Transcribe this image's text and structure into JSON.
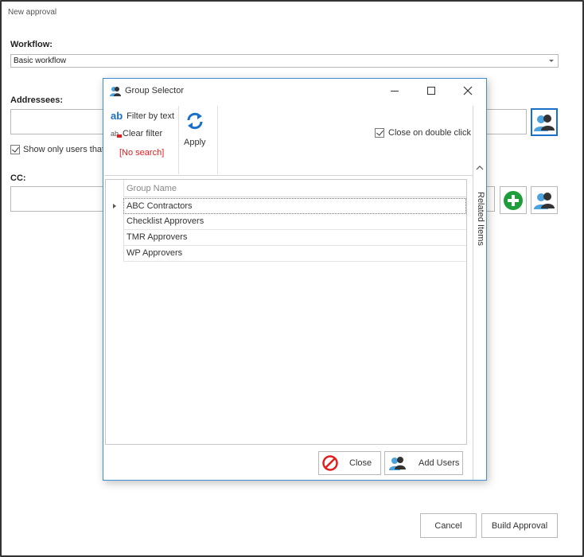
{
  "window": {
    "title": "New approval"
  },
  "form": {
    "workflow_label": "Workflow:",
    "workflow_value": "Basic workflow",
    "addressees_label": "Addressees:",
    "show_only_label": "Show only users that c",
    "cc_label": "CC:"
  },
  "footer": {
    "cancel_label": "Cancel",
    "build_label": "Build Approval"
  },
  "dialog": {
    "title": "Group Selector",
    "ribbon": {
      "filter_by_text": "Filter by text",
      "clear_filter": "Clear filter",
      "no_search": "[No search]",
      "apply": "Apply",
      "close_on_double_click": "Close on double click"
    },
    "side_tab": "Related Items",
    "grid": {
      "column_header": "Group Name",
      "rows": [
        "ABC Contractors",
        "Checklist Approvers",
        "TMR Approvers",
        "WP Approvers"
      ]
    },
    "buttons": {
      "close": "Close",
      "add_users": "Add Users"
    }
  },
  "colors": {
    "accent": "#1a6fc9",
    "add_green": "#1f9d3a",
    "no_search_red": "#e02020",
    "users_icon_blue": "#4aa3df"
  }
}
